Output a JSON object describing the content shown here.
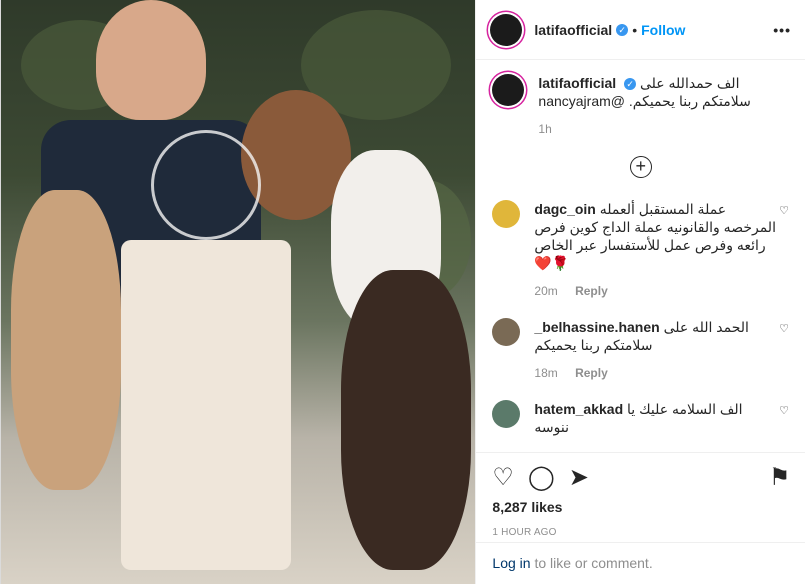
{
  "header": {
    "username": "latifaofficial",
    "dot": "•",
    "follow_label": "Follow",
    "more_label": "•••"
  },
  "caption": {
    "username": "latifaofficial",
    "text": "الف حمدالله على سلامتكم ربنا يحميكم. @nancyajram",
    "time": "1h"
  },
  "comments": [
    {
      "username": "dagc_oin",
      "text": "عملة المستقبل ألعمله المرخصه والقانونيه عملة الداج كوين فرص رائعه وفرص عمل للأستفسار عبر الخاص 🌹❤️",
      "time": "20m",
      "reply": "Reply"
    },
    {
      "username": "_belhassine.hanen",
      "text": "الحمد الله على سلامتكم ربنا يحميكم",
      "time": "18m",
      "reply": "Reply"
    },
    {
      "username": "hatem_akkad",
      "text": "الف السلامه عليك يا ننوسه",
      "time": "",
      "reply": ""
    }
  ],
  "post": {
    "likes": "8,287 likes",
    "ago": "1 HOUR AGO"
  },
  "login": {
    "link": "Log in",
    "rest": " to like or comment."
  },
  "icons": {
    "heart": "♡",
    "comment": "◯",
    "share": "➤",
    "bookmark": "⚑",
    "load_more": "+",
    "verified": "✓"
  }
}
